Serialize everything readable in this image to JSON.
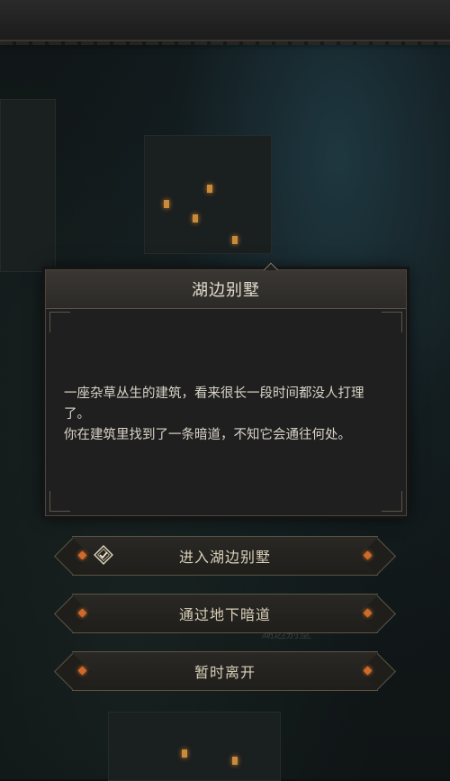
{
  "dialog": {
    "title": "湖边别墅",
    "paragraphs": [
      "一座杂草丛生的建筑，看来很长一段时间都没人打理了。",
      "你在建筑里找到了一条暗道，不知它会通往何处。"
    ]
  },
  "options": [
    {
      "label": "进入湖边别墅",
      "icon": "diamond-check-icon"
    },
    {
      "label": "通过地下暗道"
    },
    {
      "label": "暂时离开"
    }
  ],
  "background": {
    "map_label": "湖边别墅"
  },
  "colors": {
    "accent_gem": "#d06a2a",
    "text": "#d9d4c8",
    "border": "#5b5445"
  }
}
